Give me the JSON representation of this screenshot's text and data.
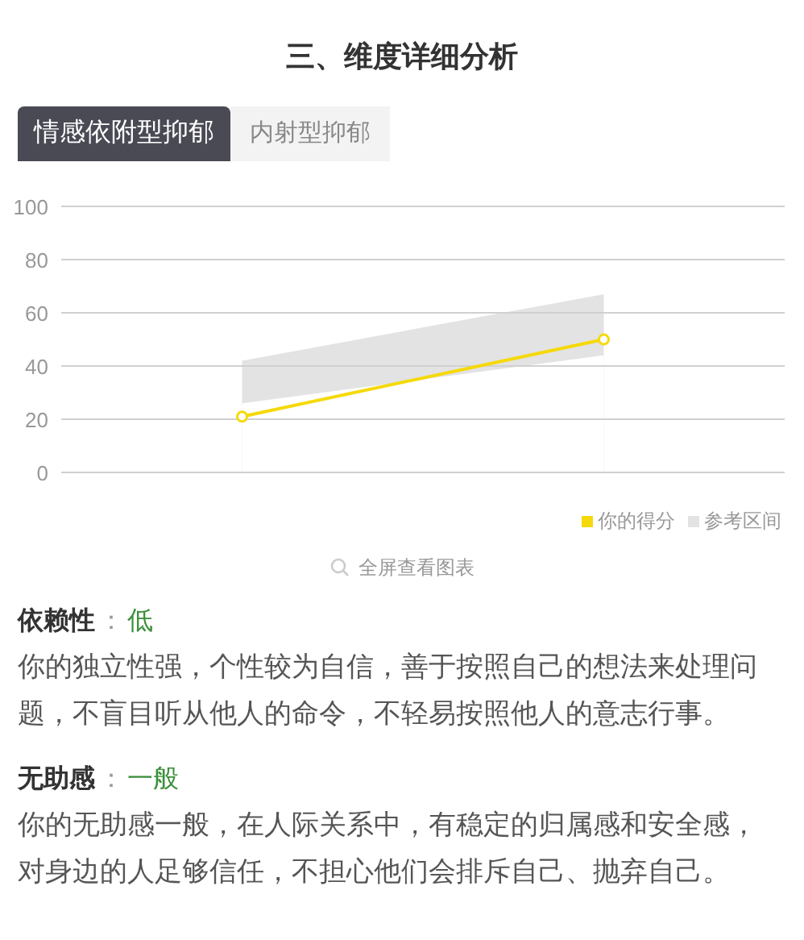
{
  "title": "三、维度详细分析",
  "tabs": [
    {
      "label": "情感依附型抑郁",
      "selected": true
    },
    {
      "label": "内射型抑郁",
      "selected": false
    }
  ],
  "chart": {
    "chart_data": {
      "type": "line",
      "categories": [
        null,
        null
      ],
      "grid": true,
      "ylim": [
        0,
        100
      ],
      "yticks": [
        {
          "value": 100,
          "label": "100"
        },
        {
          "value": 80,
          "label": "80"
        },
        {
          "value": 60,
          "label": "60"
        },
        {
          "value": 40,
          "label": "40"
        },
        {
          "value": 20,
          "label": "20"
        },
        {
          "value": 0,
          "label": "0"
        }
      ],
      "series": [
        {
          "name": "你的得分",
          "color": "#f5d90a",
          "marker": "circle",
          "values": [
            21,
            50
          ]
        },
        {
          "name": "参考区间",
          "type": "area",
          "color": "#e3e3e3",
          "values": [
            42,
            67
          ]
        },
        {
          "type": "area",
          "color": "#ffffff",
          "values": [
            26,
            44
          ]
        }
      ]
    }
  },
  "fullscreen_link": "全屏查看图表",
  "sections": [
    {
      "label": "依赖性",
      "separator": "：",
      "level": "低",
      "text": "你的独立性强，个性较为自信，善于按照自己的想法来处理问题，不盲目听从他人的命令，不轻易按照他人的意志行事。"
    },
    {
      "label": "无助感",
      "separator": "：",
      "level": "一般",
      "text": "你的无助感一般，在人际关系中，有稳定的归属感和安全感，对身边的人足够信任，不担心他们会排斥自己、抛弃自己。"
    }
  ]
}
